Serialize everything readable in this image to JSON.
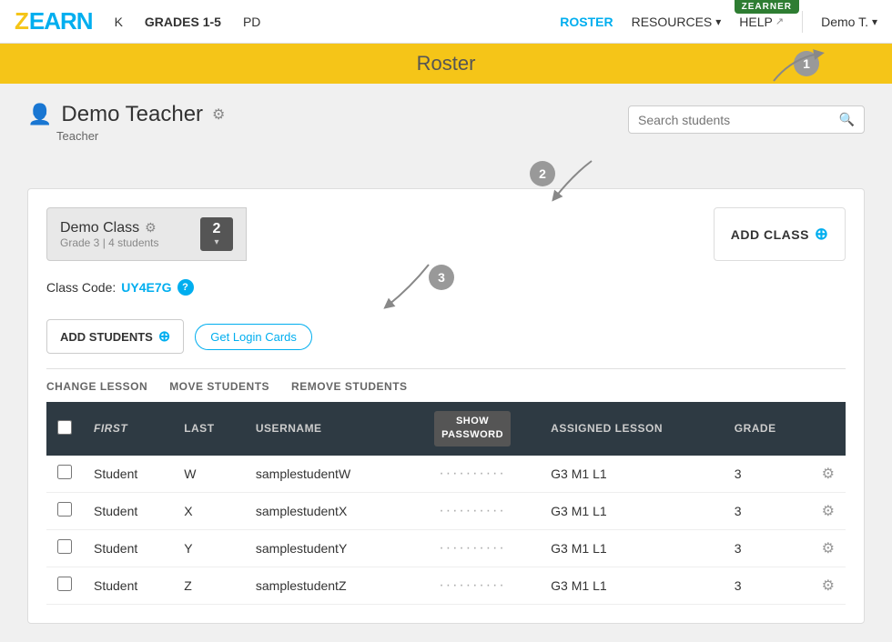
{
  "app": {
    "logo_z": "Z",
    "logo_earn": "EARN",
    "zeaner_badge": "ZEARNER"
  },
  "nav": {
    "links": [
      {
        "id": "k",
        "label": "K"
      },
      {
        "id": "grades",
        "label": "GRADES 1-5"
      },
      {
        "id": "pd",
        "label": "PD"
      },
      {
        "id": "roster",
        "label": "ROSTER",
        "active": true
      },
      {
        "id": "resources",
        "label": "RESOURCES",
        "hasDropdown": true
      },
      {
        "id": "help",
        "label": "HELP",
        "hasExternal": true
      }
    ],
    "user": "Demo T.",
    "user_chevron": "▾"
  },
  "banner": {
    "title": "Roster"
  },
  "teacher": {
    "name": "Demo Teacher",
    "role": "Teacher",
    "settings_icon": "⚙"
  },
  "search": {
    "placeholder": "Search students",
    "icon": "🔍"
  },
  "class": {
    "name": "Demo Class",
    "grade_info": "Grade 3 | 4 students",
    "count": "2",
    "gear_icon": "⚙",
    "class_code_label": "Class Code:",
    "class_code": "UY4E7G"
  },
  "buttons": {
    "add_class": "ADD CLASS",
    "add_students": "ADD STUDENTS",
    "get_login_cards": "Get Login Cards"
  },
  "table_actions": [
    {
      "id": "change_lesson",
      "label": "CHANGE LESSON"
    },
    {
      "id": "move_students",
      "label": "MOVE STUDENTS"
    },
    {
      "id": "remove_students",
      "label": "REMOVE STUDENTS"
    }
  ],
  "table": {
    "headers": [
      {
        "id": "checkbox",
        "label": ""
      },
      {
        "id": "first",
        "label": "FIRST",
        "italic": true
      },
      {
        "id": "last",
        "label": "LAST"
      },
      {
        "id": "username",
        "label": "USERNAME"
      },
      {
        "id": "show_password",
        "label": "SHOW\nPASSWORD"
      },
      {
        "id": "assigned_lesson",
        "label": "ASSIGNED LESSON"
      },
      {
        "id": "grade",
        "label": "GRADE"
      },
      {
        "id": "actions",
        "label": ""
      }
    ],
    "rows": [
      {
        "first": "Student",
        "last": "W",
        "username": "samplestudentW",
        "password": "··········",
        "lesson": "G3 M1 L1",
        "grade": "3"
      },
      {
        "first": "Student",
        "last": "X",
        "username": "samplestudentX",
        "password": "··········",
        "lesson": "G3 M1 L1",
        "grade": "3"
      },
      {
        "first": "Student",
        "last": "Y",
        "username": "samplestudentY",
        "password": "··········",
        "lesson": "G3 M1 L1",
        "grade": "3"
      },
      {
        "first": "Student",
        "last": "Z",
        "username": "samplestudentZ",
        "password": "··········",
        "lesson": "G3 M1 L1",
        "grade": "3"
      }
    ]
  },
  "annotations": {
    "a1": "1",
    "a2": "2",
    "a3": "3"
  },
  "colors": {
    "logo_yellow": "#f5c518",
    "logo_blue": "#00aeef",
    "roster_active": "#00aeef",
    "banner_bg": "#f5c518",
    "table_header_bg": "#2e3a43",
    "show_pw_bg": "#555555",
    "zeaner_bg": "#2e7d32"
  }
}
